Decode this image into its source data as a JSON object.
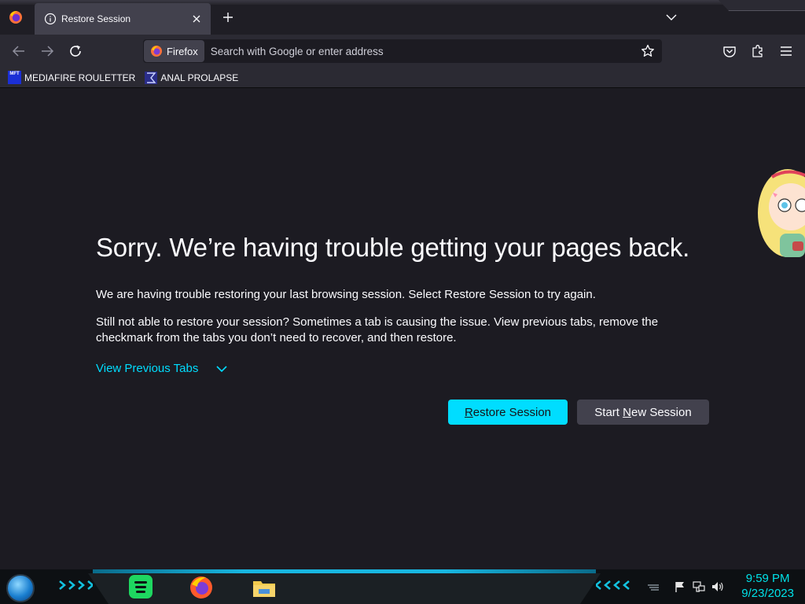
{
  "browser": {
    "tab": {
      "title": "Restore Session"
    },
    "identity_label": "Firefox",
    "url_placeholder": "Search with Google or enter address",
    "bookmarks": [
      {
        "label": "MEDIAFIRE ROULETTER",
        "favicon_text": "MFT",
        "icon": "mediafire-roulette-favicon"
      },
      {
        "label": "ANAL PROLAPSE",
        "icon": "sigma-favicon"
      }
    ]
  },
  "page": {
    "title": "Sorry. We’re having trouble getting your pages back.",
    "paragraph1": "We are having trouble restoring your last browsing session. Select Restore Session to try again.",
    "paragraph2": "Still not able to restore your session? Sometimes a tab is causing the issue. View previous tabs, remove the checkmark from the tabs you don’t need to recover, and then restore.",
    "view_previous_tabs": "View Previous Tabs",
    "restore_button": {
      "label": "Restore Session",
      "access_key": "R"
    },
    "new_session_button": {
      "label": "Start New Session",
      "access_key": "N"
    }
  },
  "taskbar": {
    "apps": [
      "spotify-icon",
      "firefox-icon",
      "file-explorer-icon"
    ],
    "clock": {
      "time": "9:59 PM",
      "date": "9/23/2023"
    }
  },
  "colors": {
    "accent": "#00ddff",
    "page_bg": "#1c1b22",
    "toolbar_bg": "#2b2a33",
    "clock": "#00e1e8"
  }
}
